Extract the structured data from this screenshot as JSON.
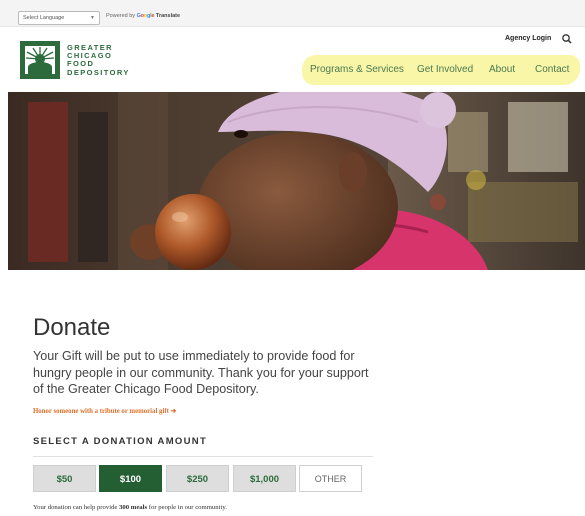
{
  "translate_bar": {
    "select_language": "Select Language",
    "powered_by": "Powered by",
    "google": [
      "G",
      "o",
      "o",
      "g",
      "l",
      "e"
    ],
    "translate": "Translate"
  },
  "header": {
    "logo_lines": [
      "GREATER",
      "CHICAGO",
      "FOOD",
      "DEPOSITORY"
    ],
    "agency_login": "Agency Login",
    "nav": {
      "programs": "Programs & Services",
      "get_involved": "Get Involved",
      "about": "About",
      "contact": "Contact"
    }
  },
  "main": {
    "title": "Donate",
    "intro": "Your Gift will be put to use immediately to provide food for hungry people in our community. Thank you for your support of the Greater Chicago Food Depository.",
    "tribute_link": "Honor someone with a tribute or memorial gift ➔",
    "section_heading": "SELECT A DONATION AMOUNT",
    "amounts": [
      "$50",
      "$100",
      "$250",
      "$1,000",
      "OTHER"
    ],
    "selected_amount": "$100",
    "meals_note": {
      "prefix": "Your donation can help provide ",
      "highlight": "300 meals",
      "suffix": " for people in our community."
    }
  },
  "colors": {
    "brand_green": "#2d6b3c",
    "selected_green": "#245f33",
    "accent_orange": "#e0702a",
    "highlight_yellow": "#f8f59d"
  }
}
